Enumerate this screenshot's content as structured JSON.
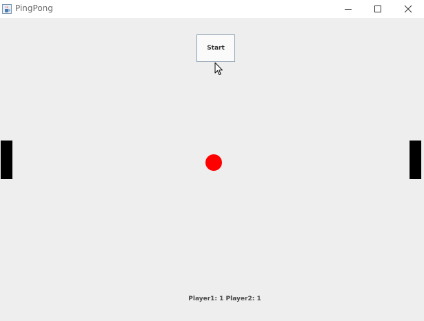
{
  "window": {
    "title": "PingPong",
    "app_icon": "java-cup-icon",
    "controls": [
      "minimize-icon",
      "maximize-icon",
      "close-icon"
    ]
  },
  "game": {
    "start_label": "Start",
    "score_text": "Player1: 1 Player2: 1",
    "ball_color": "#ff0000",
    "paddle_color": "#000000",
    "background_color": "#eeeeee"
  }
}
